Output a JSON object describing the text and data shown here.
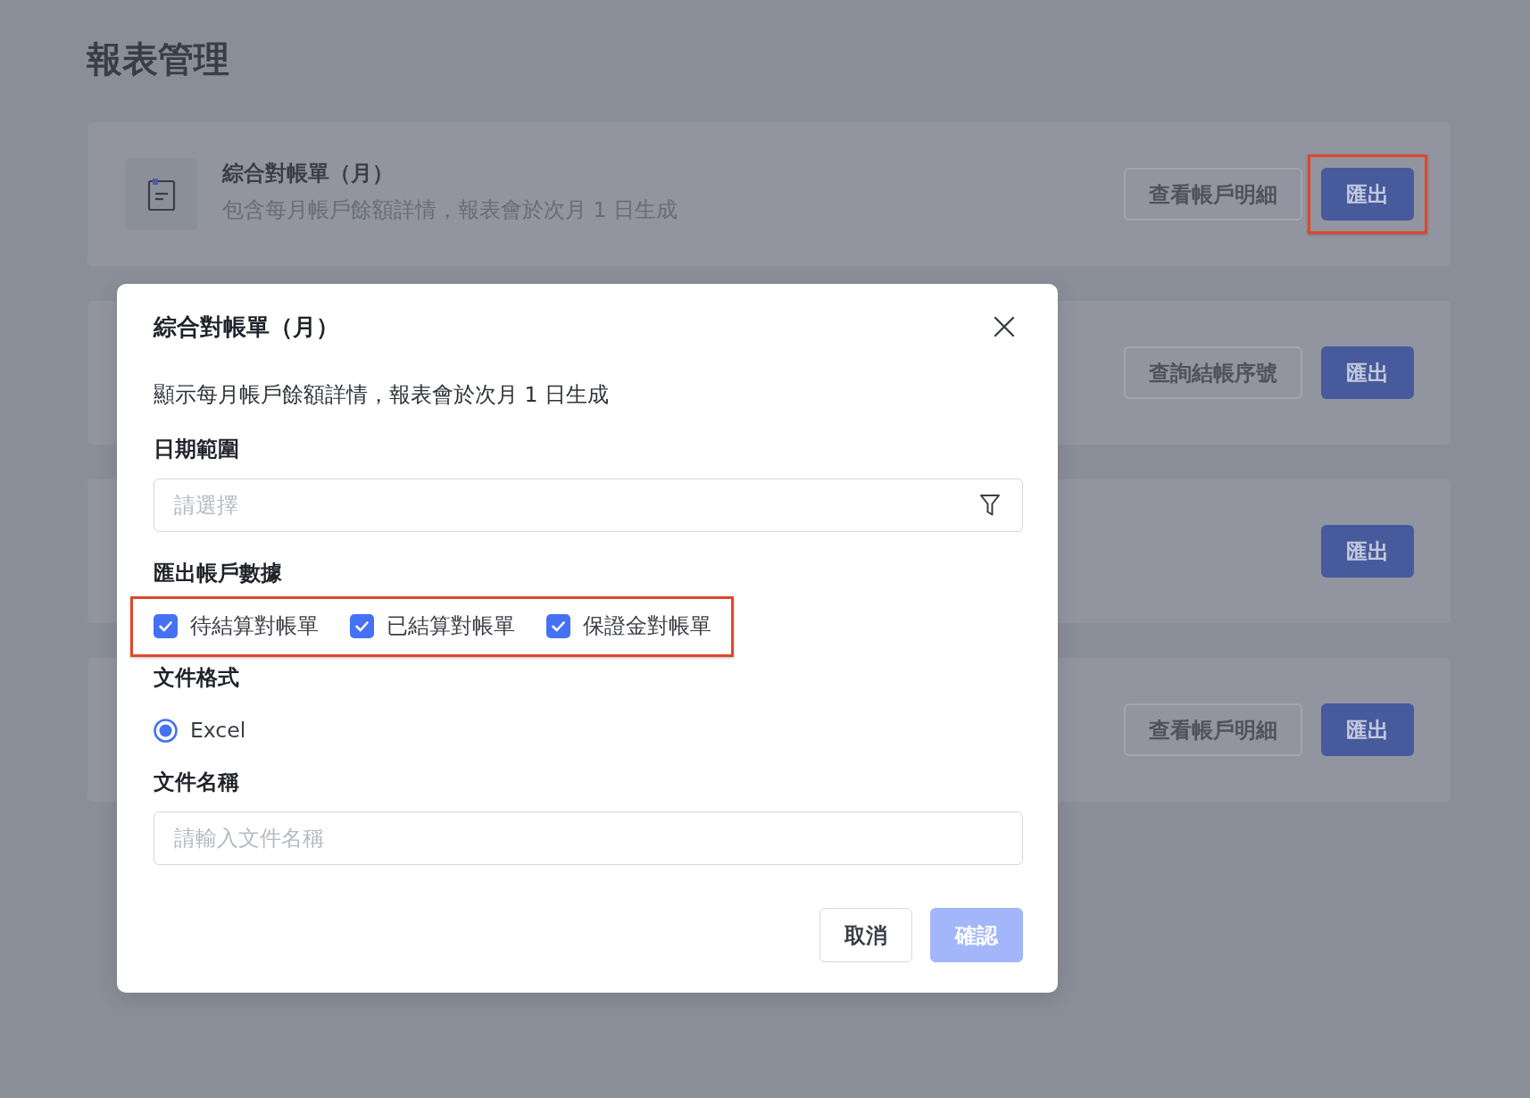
{
  "page": {
    "title": "報表管理"
  },
  "reports": [
    {
      "title": "綜合對帳單（月）",
      "description": "包含每月帳戶餘額詳情，報表會於次月 1 日生成",
      "buttons": [
        {
          "label": "查看帳戶明細",
          "kind": "outline",
          "highlighted": false
        },
        {
          "label": "匯出",
          "kind": "primary",
          "highlighted": true
        }
      ]
    },
    {
      "buttons": [
        {
          "label": "查詢結帳序號",
          "kind": "outline",
          "highlighted": false
        },
        {
          "label": "匯出",
          "kind": "primary",
          "highlighted": false
        }
      ]
    },
    {
      "buttons": [
        {
          "label": "匯出",
          "kind": "primary",
          "highlighted": false
        }
      ]
    },
    {
      "buttons": [
        {
          "label": "查看帳戶明細",
          "kind": "outline",
          "highlighted": false
        },
        {
          "label": "匯出",
          "kind": "primary",
          "highlighted": false
        }
      ]
    }
  ],
  "dialog": {
    "title": "綜合對帳單（月）",
    "description": "顯示每月帳戶餘額詳情，報表會於次月 1 日生成",
    "fields": [
      {
        "kind": "select",
        "label": "日期範圍",
        "placeholder": "請選擇"
      },
      {
        "kind": "checkboxes",
        "label": "匯出帳戶數據",
        "highlighted": true,
        "options": [
          {
            "label": "待結算對帳單",
            "checked": true
          },
          {
            "label": "已結算對帳單",
            "checked": true
          },
          {
            "label": "保證金對帳單",
            "checked": true
          }
        ]
      },
      {
        "kind": "radios",
        "label": "文件格式",
        "options": [
          {
            "label": "Excel",
            "selected": true
          }
        ]
      },
      {
        "kind": "text",
        "label": "文件名稱",
        "placeholder": "請輸入文件名稱"
      }
    ],
    "buttons": [
      {
        "label": "取消",
        "kind": "secondary",
        "disabled": false
      },
      {
        "label": "確認",
        "kind": "primary",
        "disabled": true
      }
    ]
  }
}
